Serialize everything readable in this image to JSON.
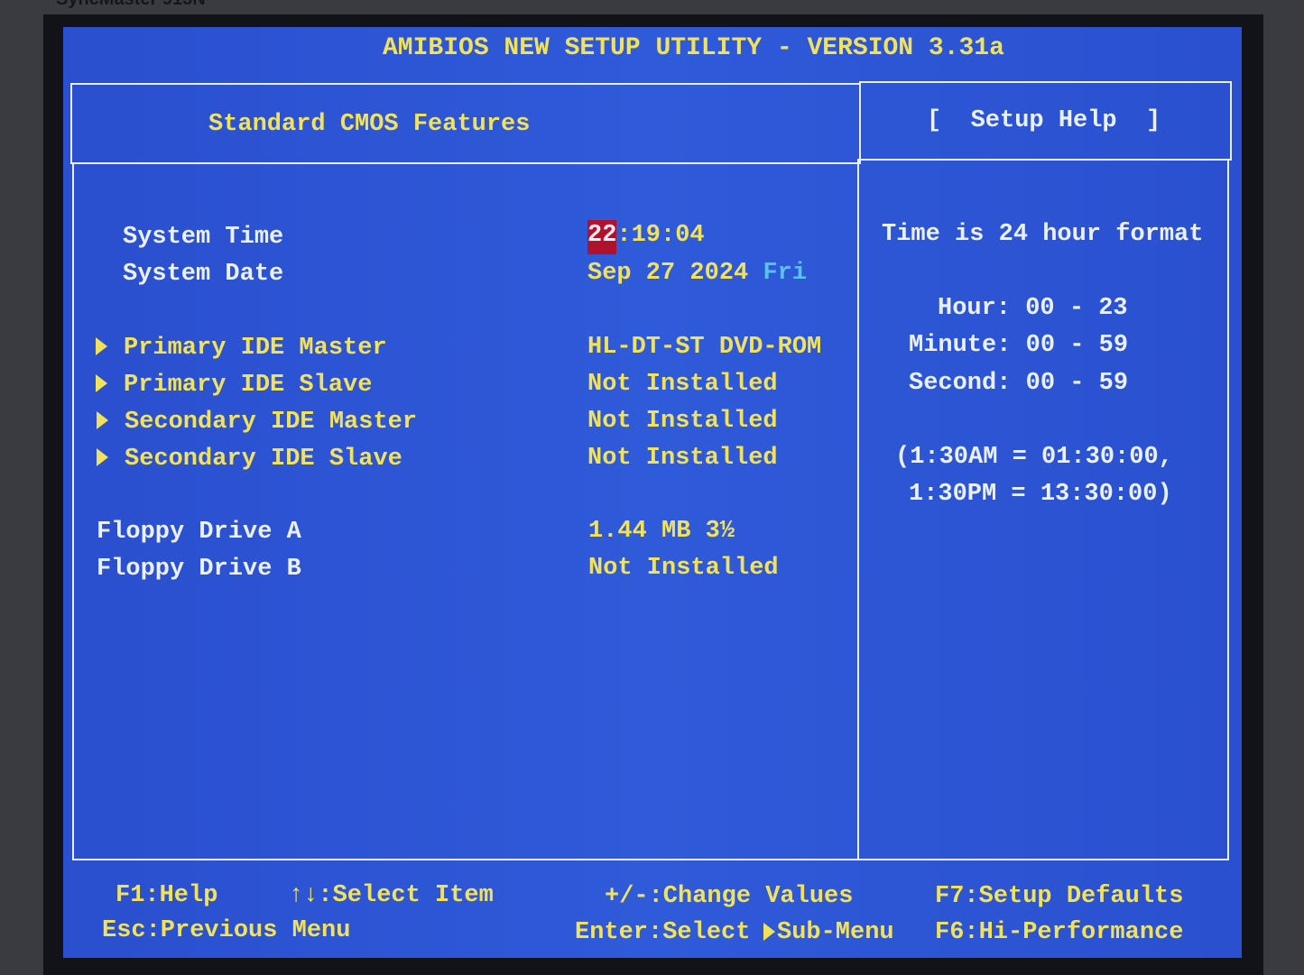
{
  "monitor": {
    "brand": "SyncMaster 913N"
  },
  "title": "AMIBIOS NEW SETUP UTILITY - VERSION 3.31a",
  "page_title": "Standard CMOS Features",
  "help_title": "[  Setup Help  ]",
  "colors": {
    "background": "#2c55d5",
    "text_yellow": "#f2e25a",
    "text_white": "#eaf0fa",
    "highlight": "#b0122e",
    "day_cyan": "#55c4ec"
  },
  "fields": {
    "system_time": {
      "label": "System Time",
      "hour": "22",
      "rest": ":19:04"
    },
    "system_date": {
      "label": "System Date",
      "date": "Sep 27 2024",
      "day": "Fri"
    }
  },
  "submenus": [
    {
      "label": "Primary IDE Master",
      "value": "HL-DT-ST DVD-ROM"
    },
    {
      "label": "Primary IDE Slave",
      "value": "Not Installed"
    },
    {
      "label": "Secondary IDE Master",
      "value": "Not Installed"
    },
    {
      "label": "Secondary IDE Slave",
      "value": "Not Installed"
    }
  ],
  "floppy": [
    {
      "label": "Floppy Drive A",
      "value": "1.44 MB 3½"
    },
    {
      "label": "Floppy Drive B",
      "value": "Not Installed"
    }
  ],
  "help": {
    "line1": "Time is 24 hour format",
    "hour": "Hour: 00 - 23",
    "minute": "Minute: 00 - 59",
    "second": "Second: 00 - 59",
    "ex1": "(1:30AM = 01:30:00,",
    "ex2": "1:30PM = 13:30:00)"
  },
  "footer": {
    "f1": "F1:Help",
    "select_item": "↑↓:Select Item",
    "change": "+/-:Change Values",
    "f7": "F7:Setup Defaults",
    "esc": "Esc:Previous Menu",
    "enter": "Enter:Select",
    "submenu": "Sub-Menu",
    "f6": "F6:Hi-Performance"
  }
}
